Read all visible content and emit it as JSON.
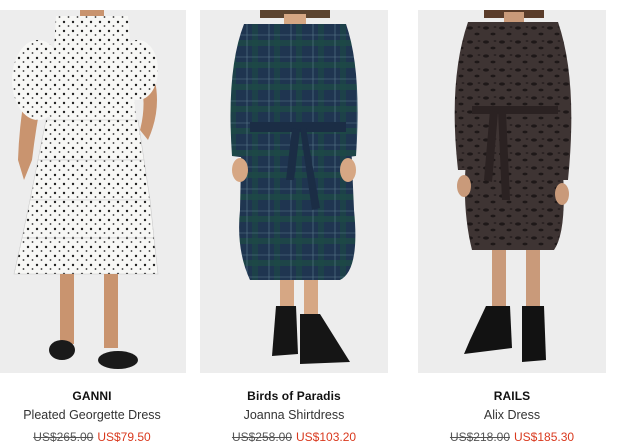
{
  "products": [
    {
      "brand": "GANNI",
      "name": "Pleated Georgette Dress",
      "original_price": "US$265.00",
      "sale_price": "US$79.50",
      "image": "white-polka-dot-tiered-dress-photo"
    },
    {
      "brand": "Birds of Paradis",
      "name": "Joanna Shirtdress",
      "original_price": "US$258.00",
      "sale_price": "US$103.20",
      "image": "navy-plaid-shirtdress-photo"
    },
    {
      "brand": "RAILS",
      "name": "Alix Dress",
      "original_price": "US$218.00",
      "sale_price": "US$185.30",
      "image": "charcoal-animal-print-shirtdress-photo"
    }
  ],
  "colors": {
    "photo_background": "#ededed",
    "sale_price": "#d9391e",
    "original_price": "#555555",
    "brand_text": "#111111"
  }
}
